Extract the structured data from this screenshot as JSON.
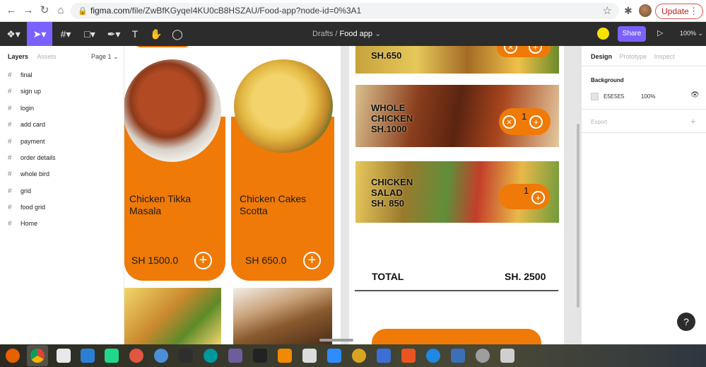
{
  "browser": {
    "url_host": "figma.com",
    "url_path": "/file/ZwBfKGyqeI4KU0cB8HSZAU/Food-app?node-id=0%3A1",
    "update_label": "Update"
  },
  "figma_toolbar": {
    "breadcrumb_drafts": "Drafts",
    "breadcrumb_sep": "/",
    "file_name": "Food app",
    "share_label": "Share",
    "zoom": "100%"
  },
  "layers_panel": {
    "tabs": [
      "Layers",
      "Assets"
    ],
    "page": "Page 1",
    "layers": [
      "final",
      "sign up",
      "login",
      "add card",
      "payment",
      "order details",
      "whole bird",
      "grid",
      "food grid",
      "Home"
    ]
  },
  "food_grid": {
    "items": [
      {
        "name_line1": "Chicken Tikka",
        "name_line2": "Masala",
        "price": "SH 1500.0"
      },
      {
        "name_line1": "Chicken Cakes",
        "name_line2": "Scotta",
        "price": "SH 650.0"
      }
    ]
  },
  "order_details": {
    "items": [
      {
        "line1": "",
        "line2": "SH.650",
        "qty": ""
      },
      {
        "line1": "WHOLE",
        "line2": "CHICKEN",
        "line3": "SH.1000",
        "qty": "1"
      },
      {
        "line1": "CHICKEN",
        "line2": "SALAD",
        "line3": "SH. 850",
        "qty": "1"
      }
    ],
    "total_label": "TOTAL",
    "total_value": "SH. 2500"
  },
  "design_panel": {
    "tabs": [
      "Design",
      "Prototype",
      "Inspect"
    ],
    "background_label": "Background",
    "background_hex": "E5E5E5",
    "background_opacity": "100%",
    "export_label": "Export"
  },
  "colors": {
    "accent_orange": "#ef7a07",
    "figma_purple": "#7b61ff",
    "canvas_bg": "#e5e5e5"
  }
}
